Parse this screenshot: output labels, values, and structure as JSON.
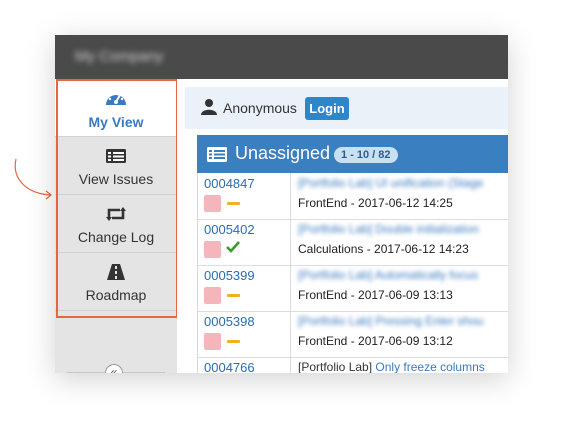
{
  "app": {
    "brand": "My Company"
  },
  "sidebar": {
    "items": [
      {
        "label": "My View",
        "icon": "dashboard-icon",
        "active": true
      },
      {
        "label": "View Issues",
        "icon": "list-icon"
      },
      {
        "label": "Change Log",
        "icon": "retweet-icon"
      },
      {
        "label": "Roadmap",
        "icon": "road-icon"
      }
    ],
    "collapse_label": "«"
  },
  "user": {
    "name": "Anonymous",
    "login_label": "Login"
  },
  "panel": {
    "title": "Unassigned",
    "count": "1 - 10 / 82",
    "rows": [
      {
        "id": "0004847",
        "summary": "[Portfolio Lab] UI unification (Stage",
        "meta": "FrontEnd - 2017-06-12 14:25",
        "status": "dash"
      },
      {
        "id": "0005402",
        "summary": "[Portfolio Lab] Double initialization",
        "meta": "Calculations - 2017-06-12 14:23",
        "status": "check"
      },
      {
        "id": "0005399",
        "summary": "[Portfolio Lab] Automatically focus",
        "meta": "FrontEnd - 2017-06-09 13:13",
        "status": "dash"
      },
      {
        "id": "0005398",
        "summary": "[Portfolio Lab] Pressing Enter shou",
        "meta": "FrontEnd - 2017-06-09 13:12",
        "status": "dash"
      },
      {
        "id": "0004766",
        "project": "[Portfolio Lab]",
        "summary_link": "Only freeze columns",
        "meta": "",
        "status": ""
      }
    ]
  },
  "colors": {
    "accent": "#3a7fbf",
    "highlight": "#e8663f",
    "priority": "#f4b6bb",
    "status_minor": "#f2b01e",
    "status_ok": "#3a9a2e"
  }
}
